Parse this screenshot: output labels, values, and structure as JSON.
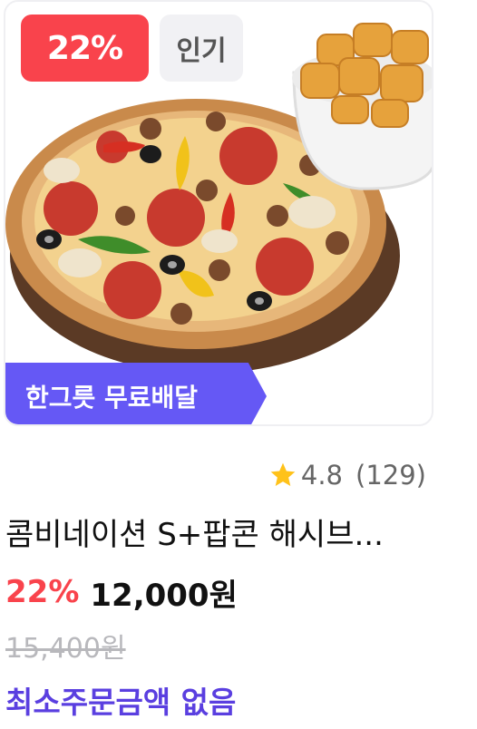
{
  "card": {
    "discount_badge": "22%",
    "popular_badge": "인기",
    "delivery_banner": "한그릇 무료배달",
    "image_icon": "pizza-and-hash-brown-icon"
  },
  "rating": {
    "icon": "star-icon",
    "score": "4.8",
    "count": "(129)",
    "star_color": "#FFC21A"
  },
  "product": {
    "name": "콤비네이션 S+팝콘 해시브...",
    "discount_rate": "22%",
    "price": "12,000원",
    "original_price": "15,400원",
    "min_order": "최소주문금액 없음"
  },
  "colors": {
    "discount": "#F9434C",
    "banner": "#6558F5",
    "min_order": "#5A3FE0"
  }
}
